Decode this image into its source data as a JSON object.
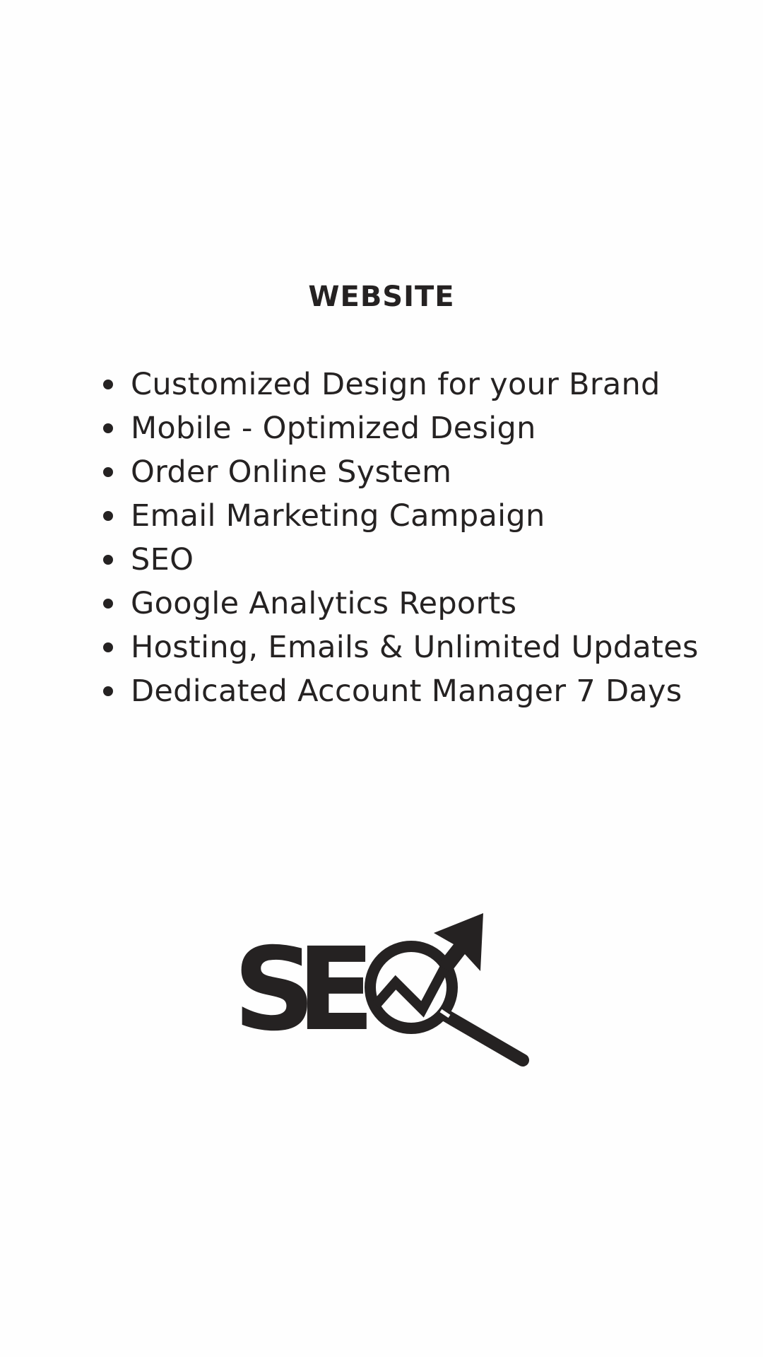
{
  "section": {
    "title": "WEBSITE"
  },
  "features": [
    "Customized Design for your Brand",
    "Mobile - Optimized Design",
    "Order Online System",
    "Email Marketing Campaign",
    "SEO",
    "Google Analytics Reports",
    "Hosting, Emails & Unlimited Updates",
    "Dedicated Account Manager 7 Days"
  ],
  "logo": {
    "text": "SEO",
    "icon": "magnifier-growth-arrow-icon"
  },
  "colors": {
    "text": "#252222",
    "background": "#fefefe"
  }
}
